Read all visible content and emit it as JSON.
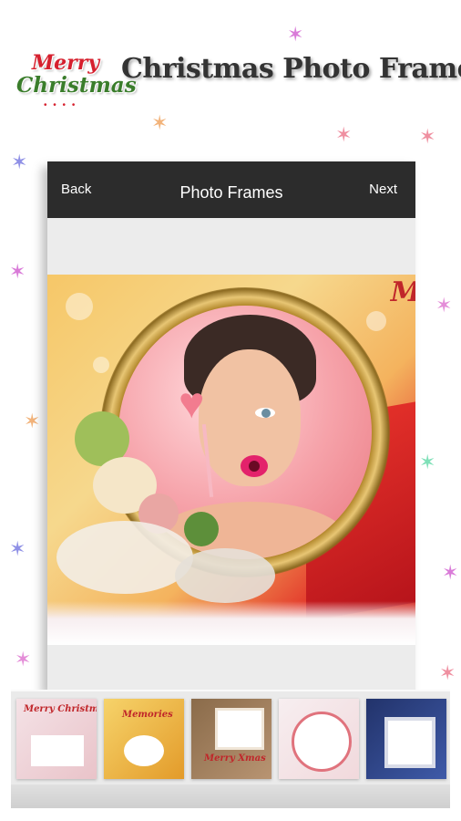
{
  "promo": {
    "logo_line1": "Merry",
    "logo_line2": "Christmas",
    "title": "Christmas Photo Frame"
  },
  "appbar": {
    "back_label": "Back",
    "title": "Photo Frames",
    "next_label": "Next"
  },
  "preview": {
    "frame_script_text": "M"
  },
  "thumbnails": [
    {
      "name": "frame-merry-christmas",
      "text": "Merry Christmas"
    },
    {
      "name": "frame-gold-quote",
      "text": "Memories"
    },
    {
      "name": "frame-wooden",
      "text": "Merry Xmas"
    },
    {
      "name": "frame-round-ribbon",
      "text": ""
    },
    {
      "name": "frame-blue-lace",
      "text": ""
    }
  ],
  "colors": {
    "appbar_bg": "#2c2c2c",
    "screen_bg": "#ececec",
    "logo_red": "#d6202e",
    "logo_green": "#3a7d2b"
  },
  "icons": {
    "sparkle": "✶"
  }
}
